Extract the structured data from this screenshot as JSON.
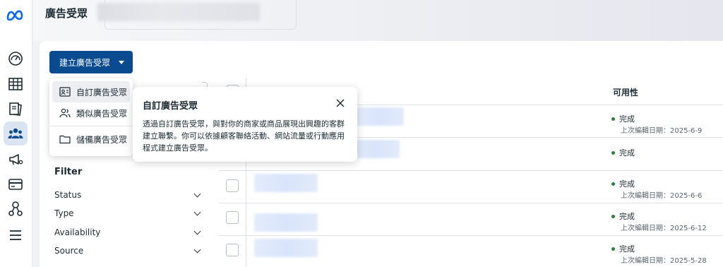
{
  "header": {
    "title": "廣告受眾"
  },
  "nav": {
    "items": [
      {
        "name": "meta-logo"
      },
      {
        "name": "dashboard-icon"
      },
      {
        "name": "table-icon"
      },
      {
        "name": "pages-icon"
      },
      {
        "name": "audiences-icon",
        "active": true
      },
      {
        "name": "campaign-icon"
      },
      {
        "name": "billing-icon"
      },
      {
        "name": "network-icon"
      },
      {
        "name": "menu-icon"
      }
    ]
  },
  "toolbar": {
    "create_label": "建立廣告受眾"
  },
  "dropdown": {
    "items": [
      {
        "label": "自訂廣告受眾",
        "icon": "contact-card-icon"
      },
      {
        "label": "類似廣告受眾",
        "icon": "people-icon"
      },
      {
        "label": "儲備廣告受眾",
        "icon": "folder-icon"
      }
    ]
  },
  "tooltip": {
    "title": "自訂廣告受眾",
    "body": "透過自訂廣告受眾，與對你的商家或商品展現出興趣的客群建立聯繫。你可以依據顧客聯絡活動、網站流量或行動應用程式建立廣告受眾。"
  },
  "filter": {
    "title": "Filter",
    "items": [
      "Status",
      "Type",
      "Availability",
      "Source"
    ]
  },
  "table": {
    "availability_header": "可用性",
    "rows": [
      {
        "status": "完成",
        "edited": "上次編輯日期：2025-6-9"
      },
      {
        "status": "完成",
        "edited": ""
      },
      {
        "status": "完成",
        "edited": "上次編輯日期：2025-6-6"
      },
      {
        "status": "完成",
        "edited": "上次編輯日期：2025-6-12"
      },
      {
        "status": "完成",
        "edited": "上次編輯日期：2025-5-28"
      }
    ]
  },
  "colors": {
    "primary": "#0a4b8f",
    "status_green": "#2f7d3b",
    "active_nav_bg": "#dbe4f3"
  }
}
